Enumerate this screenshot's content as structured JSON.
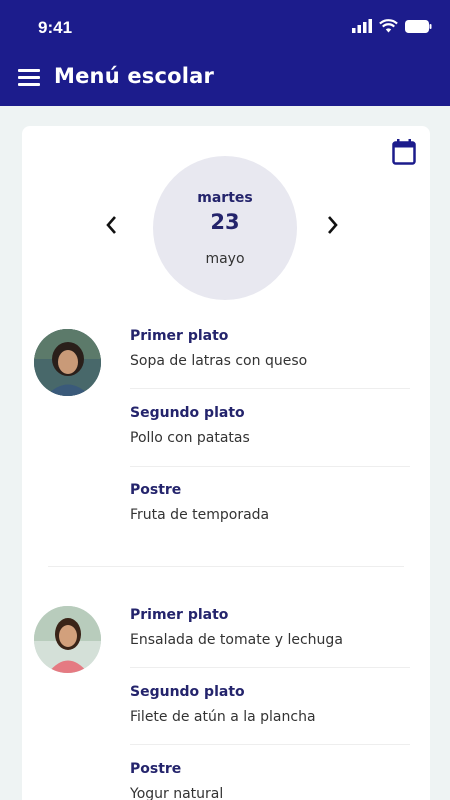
{
  "status": {
    "time": "9:41"
  },
  "appbar": {
    "title": "Menú escolar"
  },
  "date": {
    "weekday": "martes",
    "day": "23",
    "month": "mayo"
  },
  "children": [
    {
      "items": [
        {
          "label": "Primer plato",
          "value": "Sopa de latras con queso"
        },
        {
          "label": "Segundo plato",
          "value": "Pollo con patatas"
        },
        {
          "label": "Postre",
          "value": "Fruta de temporada"
        }
      ]
    },
    {
      "items": [
        {
          "label": "Primer plato",
          "value": "Ensalada de tomate y lechuga"
        },
        {
          "label": "Segundo plato",
          "value": "Filete de atún a la plancha"
        },
        {
          "label": "Postre",
          "value": "Yogur natural"
        }
      ]
    }
  ],
  "colors": {
    "primary": "#1c1c8c",
    "background": "#eef3f3",
    "date_circle": "#e8e8f0"
  }
}
